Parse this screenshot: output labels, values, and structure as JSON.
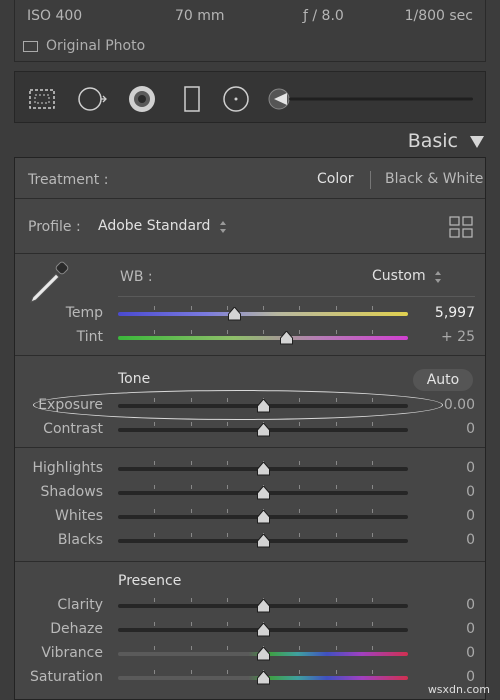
{
  "info": {
    "iso": "ISO 400",
    "focal": "70 mm",
    "aperture": "ƒ / 8.0",
    "shutter": "1/800 sec",
    "original_photo": "Original Photo"
  },
  "tools": {
    "icons": [
      "crop-overlay-icon",
      "spot-removal-icon",
      "red-eye-icon",
      "graduated-filter-icon",
      "radial-filter-icon",
      "adjustment-brush-icon"
    ],
    "brush_size": 0.02
  },
  "header": {
    "title": "Basic"
  },
  "treatment": {
    "label": "Treatment :",
    "options": [
      "Color",
      "Black & White"
    ],
    "selected": "Color"
  },
  "profile": {
    "label": "Profile :",
    "value": "Adobe Standard"
  },
  "wb": {
    "label": "WB :",
    "value": "Custom"
  },
  "sliders": [
    {
      "id": "temp",
      "label": "Temp",
      "value": "5,997",
      "pos": 0.4,
      "gradient": "temp"
    },
    {
      "id": "tint",
      "label": "Tint",
      "value": "+ 25",
      "pos": 0.58,
      "gradient": "tint"
    },
    {
      "id": "exposure",
      "label": "Exposure",
      "value": "0.00",
      "pos": 0.5,
      "gradient": "none"
    },
    {
      "id": "contrast",
      "label": "Contrast",
      "value": "0",
      "pos": 0.5,
      "gradient": "none"
    },
    {
      "id": "highlights",
      "label": "Highlights",
      "value": "0",
      "pos": 0.5,
      "gradient": "none"
    },
    {
      "id": "shadows",
      "label": "Shadows",
      "value": "0",
      "pos": 0.5,
      "gradient": "none"
    },
    {
      "id": "whites",
      "label": "Whites",
      "value": "0",
      "pos": 0.5,
      "gradient": "none"
    },
    {
      "id": "blacks",
      "label": "Blacks",
      "value": "0",
      "pos": 0.5,
      "gradient": "none"
    },
    {
      "id": "clarity",
      "label": "Clarity",
      "value": "0",
      "pos": 0.5,
      "gradient": "none"
    },
    {
      "id": "dehaze",
      "label": "Dehaze",
      "value": "0",
      "pos": 0.5,
      "gradient": "none"
    },
    {
      "id": "vibrance",
      "label": "Vibrance",
      "value": "0",
      "pos": 0.5,
      "gradient": "rainbow"
    },
    {
      "id": "saturation",
      "label": "Saturation",
      "value": "0",
      "pos": 0.5,
      "gradient": "rainbow"
    }
  ],
  "tone": {
    "label": "Tone",
    "auto": "Auto"
  },
  "presence": {
    "label": "Presence"
  },
  "watermark": "wsxdn.com"
}
